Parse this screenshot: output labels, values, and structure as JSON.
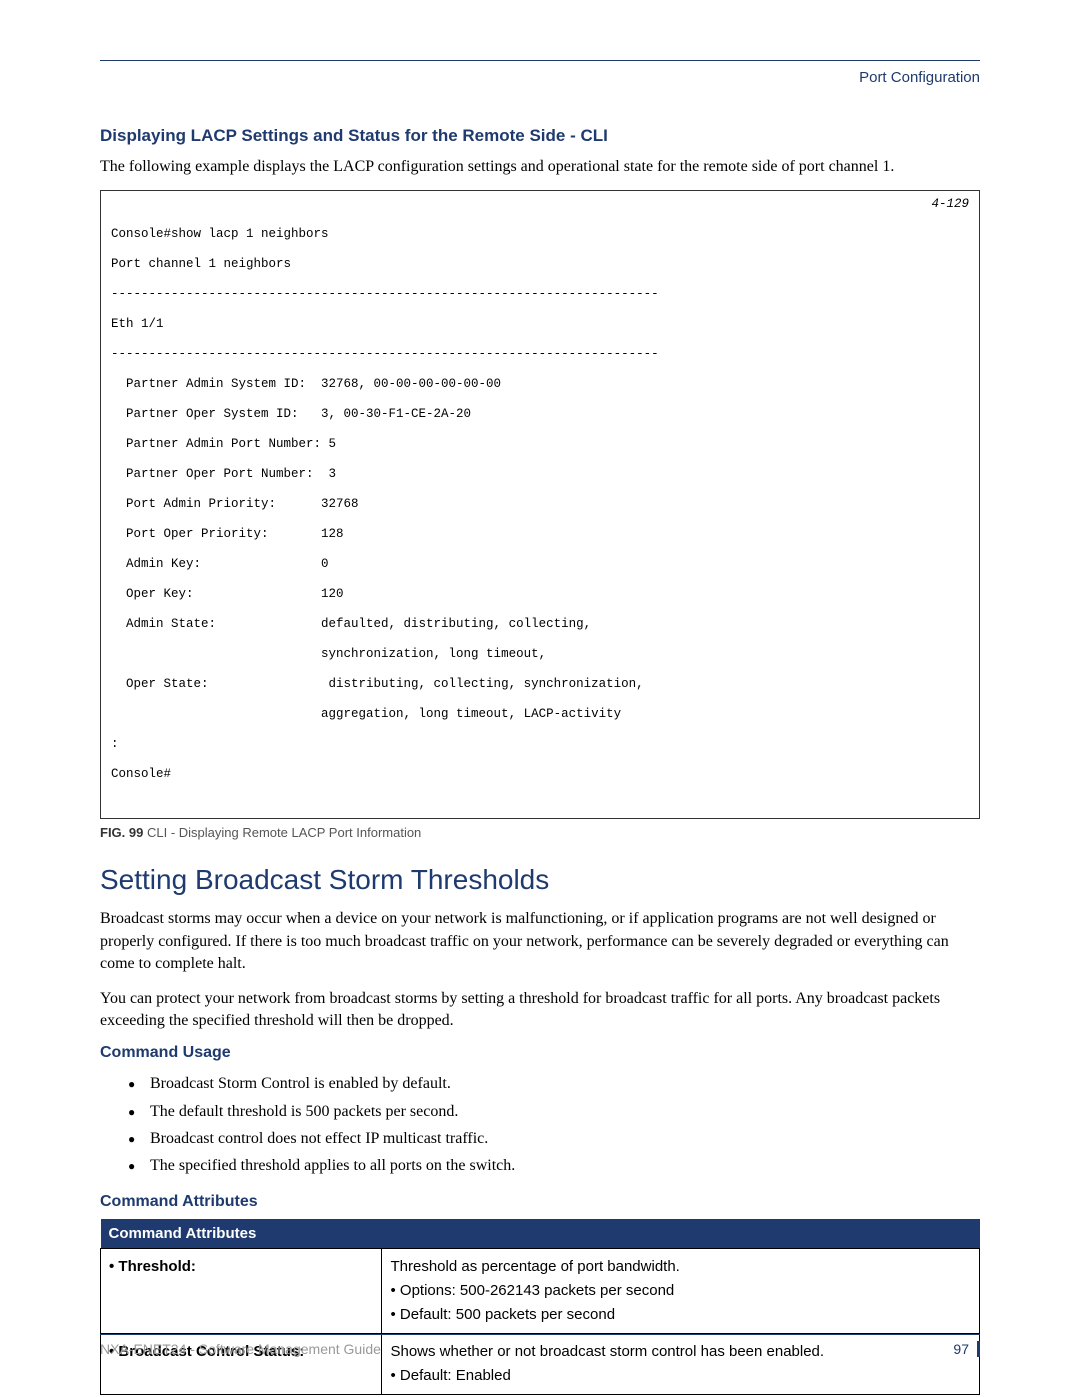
{
  "header": {
    "section": "Port Configuration"
  },
  "sec1": {
    "heading": "Displaying LACP Settings and Status for the Remote Side - CLI",
    "intro": "The following example displays the LACP configuration settings and operational state for the remote side of port channel 1."
  },
  "cli": {
    "ref": "4-129",
    "l01": "Console#show lacp 1 neighbors",
    "l02": "Port channel 1 neighbors",
    "l03": "-------------------------------------------------------------------------",
    "l04": "Eth 1/1",
    "l05": "-------------------------------------------------------------------------",
    "l06": "  Partner Admin System ID:  32768, 00-00-00-00-00-00",
    "l07": "  Partner Oper System ID:   3, 00-30-F1-CE-2A-20",
    "l08": "  Partner Admin Port Number: 5",
    "l09": "  Partner Oper Port Number:  3",
    "l10": "  Port Admin Priority:      32768",
    "l11": "  Port Oper Priority:       128",
    "l12": "  Admin Key:                0",
    "l13": "  Oper Key:                 120",
    "l14": "  Admin State:              defaulted, distributing, collecting,",
    "l15": "                            synchronization, long timeout,",
    "l16": "  Oper State:                distributing, collecting, synchronization,",
    "l17": "                            aggregation, long timeout, LACP-activity",
    "l18": ":",
    "l19": "Console#"
  },
  "fig": {
    "prefix": "FIG. 99",
    "caption": "  CLI - Displaying Remote LACP Port Information"
  },
  "sec2": {
    "heading": "Setting Broadcast Storm Thresholds",
    "p1": "Broadcast storms may occur when a device on your network is malfunctioning, or if application programs are not well designed or properly configured. If there is too much broadcast traffic on your network, performance can be severely degraded or everything can come to complete halt.",
    "p2": "You can protect your network from broadcast storms by setting a threshold for broadcast traffic for all ports. Any broadcast packets exceeding the specified threshold will then be dropped."
  },
  "usage": {
    "heading": "Command Usage",
    "items": [
      "Broadcast Storm Control is enabled by default.",
      "The default threshold is 500 packets per second.",
      "Broadcast control does not effect IP multicast traffic.",
      "The specified threshold applies to all ports on the switch."
    ]
  },
  "attributes": {
    "heading": "Command Attributes",
    "table_header": "Command Attributes",
    "rows": [
      {
        "label": "• Threshold:",
        "desc": "Threshold as percentage of port bandwidth.\n• Options: 500-262143 packets per second\n• Default: 500 packets per second"
      },
      {
        "label": "• Broadcast Control Status:",
        "desc": "Shows whether or not broadcast storm control has been enabled.\n• Default: Enabled"
      }
    ]
  },
  "footer": {
    "doc": "NXA-ENET24 - Software Management Guide",
    "page": "97"
  }
}
